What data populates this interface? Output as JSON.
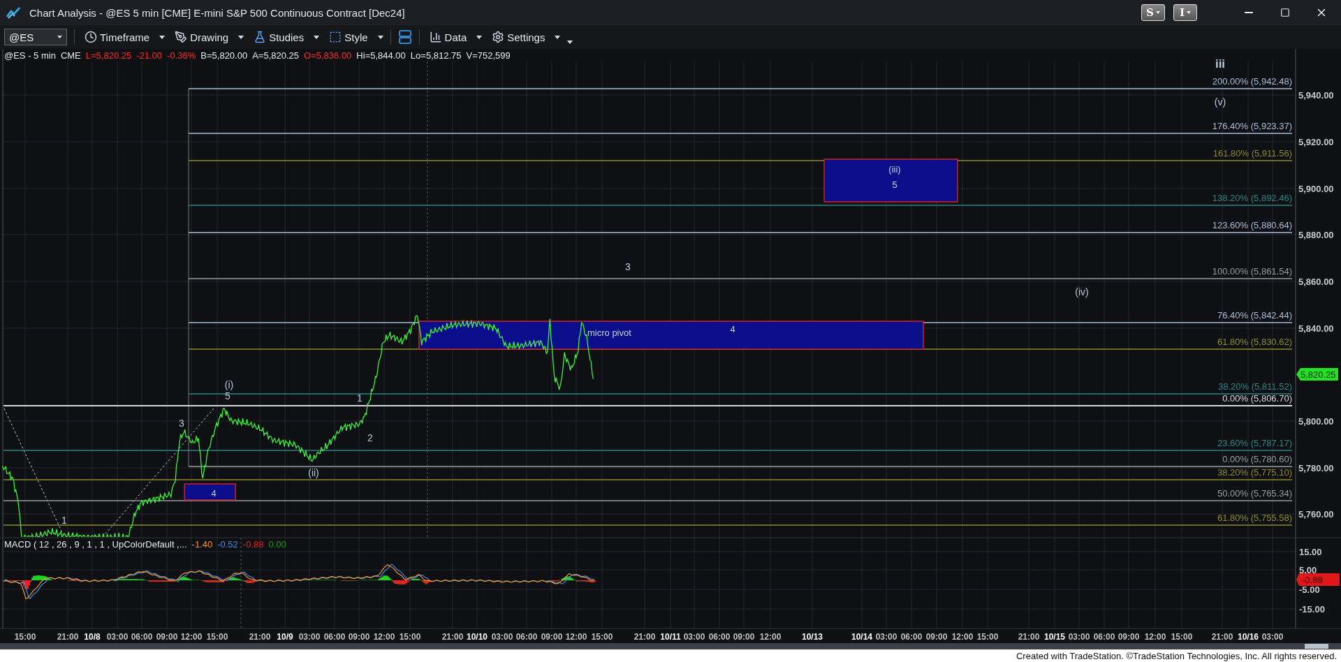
{
  "window": {
    "title": "Chart Analysis - @ES 5 min [CME] E-mini S&P 500 Continuous Contract [Dec24]"
  },
  "title_buttons": [
    "S",
    "I"
  ],
  "toolbar": {
    "symbol": "@ES",
    "menus": [
      {
        "label": "Timeframe",
        "kind": "clock"
      },
      {
        "label": "Drawing",
        "kind": "pen"
      },
      {
        "label": "Studies",
        "kind": "flask"
      },
      {
        "label": "Style",
        "kind": "style"
      },
      {
        "label": "Data",
        "kind": "data"
      },
      {
        "label": "Settings",
        "kind": "gear"
      }
    ]
  },
  "quote_line": [
    {
      "text": "@ES - 5 min",
      "color": "#e8e8e8"
    },
    {
      "text": "CME",
      "color": "#e8e8e8"
    },
    {
      "text": "L=5,820.25",
      "color": "#ff2a2a"
    },
    {
      "text": "-21.00",
      "color": "#ff2a2a"
    },
    {
      "text": "-0.36%",
      "color": "#ff2a2a"
    },
    {
      "text": "B=5,820.00",
      "color": "#e8e8e8"
    },
    {
      "text": "A=5,820.25",
      "color": "#e8e8e8"
    },
    {
      "text": "O=5,836.00",
      "color": "#ff2a2a"
    },
    {
      "text": "Hi=5,844.00",
      "color": "#e8e8e8"
    },
    {
      "text": "Lo=5,812.75",
      "color": "#e8e8e8"
    },
    {
      "text": "V=752,599",
      "color": "#e8e8e8"
    }
  ],
  "fib_levels": [
    {
      "label": "200.00% (5,942.48)",
      "color": "#a9bdd6"
    },
    {
      "label": "176.40% (5,923.37)",
      "color": "#a9bdd6"
    },
    {
      "label": "161.80% (5,911.56)",
      "color": "#8c8a2c"
    },
    {
      "label": "138.20% (5,892.46)",
      "color": "#2b8583"
    },
    {
      "label": "123.60% (5,880.64)",
      "color": "#a9bdd6"
    },
    {
      "label": "100.00% (5,861.54)",
      "color": "#9a9a9a"
    },
    {
      "label": "76.40% (5,842.44)",
      "color": "#a9bdd6"
    },
    {
      "label": "61.80% (5,830.62)",
      "color": "#8c8a2c"
    },
    {
      "label": "38.20% (5,811.52)",
      "color": "#2b8583"
    },
    {
      "label": "0.00% (5,806.70)",
      "color": "#d8d8d8"
    },
    {
      "label": "23.60% (5,787.17)",
      "color": "#2b8583"
    },
    {
      "label": "0.00% (5,780.60)",
      "color": "#9a9a9a"
    },
    {
      "label": "38.20% (5,775.10)",
      "color": "#8c8a2c"
    },
    {
      "label": "50.00% (5,765.34)",
      "color": "#9a9a9a"
    },
    {
      "label": "61.80% (5,755.58)",
      "color": "#8c8a2c"
    }
  ],
  "zones": [
    {
      "labels": [
        "(iii)",
        "5"
      ]
    },
    {
      "labels": [
        "micro pivot",
        "4"
      ]
    },
    {
      "labels": [
        "4"
      ]
    }
  ],
  "wave_labels": [
    "iii",
    "(v)",
    "3",
    "(iv)",
    "(i)",
    "5",
    "3",
    "1",
    "2",
    "(ii)",
    "1"
  ],
  "price_axis": {
    "ticks": [
      "5,940.00",
      "5,920.00",
      "5,900.00",
      "5,880.00",
      "5,860.00",
      "5,840.00",
      "5,800.00",
      "5,780.00",
      "5,760.00"
    ],
    "last_price": "5,820.25"
  },
  "macd": {
    "legend": "MACD ( 12 , 26 , 9 , 1 , 1 , UpColorDefault ,...",
    "values": [
      {
        "text": "-1.40",
        "color": "#f0982a"
      },
      {
        "text": "-0.52",
        "color": "#3f8fe8"
      },
      {
        "text": "-0.88",
        "color": "#e82020"
      },
      {
        "text": "0.00",
        "color": "#1f9a1f"
      }
    ],
    "ticks": [
      "15.00",
      "5.00",
      "-5.00",
      "-15.00"
    ],
    "last_value": "-0.88"
  },
  "time_axis": [
    {
      "label": "15:00",
      "bold": false
    },
    {
      "label": "21:00",
      "bold": false
    },
    {
      "label": "10/8",
      "bold": true
    },
    {
      "label": "03:00",
      "bold": false
    },
    {
      "label": "06:00",
      "bold": false
    },
    {
      "label": "09:00",
      "bold": false
    },
    {
      "label": "12:00",
      "bold": false
    },
    {
      "label": "15:00",
      "bold": false
    },
    {
      "label": "21:00",
      "bold": false
    },
    {
      "label": "10/9",
      "bold": true
    },
    {
      "label": "03:00",
      "bold": false
    },
    {
      "label": "06:00",
      "bold": false
    },
    {
      "label": "09:00",
      "bold": false
    },
    {
      "label": "12:00",
      "bold": false
    },
    {
      "label": "15:00",
      "bold": false
    },
    {
      "label": "21:00",
      "bold": false
    },
    {
      "label": "10/10",
      "bold": true
    },
    {
      "label": "03:00",
      "bold": false
    },
    {
      "label": "06:00",
      "bold": false
    },
    {
      "label": "09:00",
      "bold": false
    },
    {
      "label": "12:00",
      "bold": false
    },
    {
      "label": "15:00",
      "bold": false
    },
    {
      "label": "21:00",
      "bold": false
    },
    {
      "label": "10/11",
      "bold": true
    },
    {
      "label": "03:00",
      "bold": false
    },
    {
      "label": "06:00",
      "bold": false
    },
    {
      "label": "09:00",
      "bold": false
    },
    {
      "label": "12:00",
      "bold": false
    },
    {
      "label": "10/13",
      "bold": true
    },
    {
      "label": "10/14",
      "bold": true
    },
    {
      "label": "03:00",
      "bold": false
    },
    {
      "label": "06:00",
      "bold": false
    },
    {
      "label": "09:00",
      "bold": false
    },
    {
      "label": "12:00",
      "bold": false
    },
    {
      "label": "15:00",
      "bold": false
    },
    {
      "label": "21:00",
      "bold": false
    },
    {
      "label": "10/15",
      "bold": true
    },
    {
      "label": "03:00",
      "bold": false
    },
    {
      "label": "06:00",
      "bold": false
    },
    {
      "label": "09:00",
      "bold": false
    },
    {
      "label": "12:00",
      "bold": false
    },
    {
      "label": "15:00",
      "bold": false
    },
    {
      "label": "21:00",
      "bold": false
    },
    {
      "label": "10/16",
      "bold": true
    },
    {
      "label": "03:00",
      "bold": false
    }
  ],
  "footer": "Created with TradeStation. ©TradeStation Technologies, Inc. All rights reserved."
}
